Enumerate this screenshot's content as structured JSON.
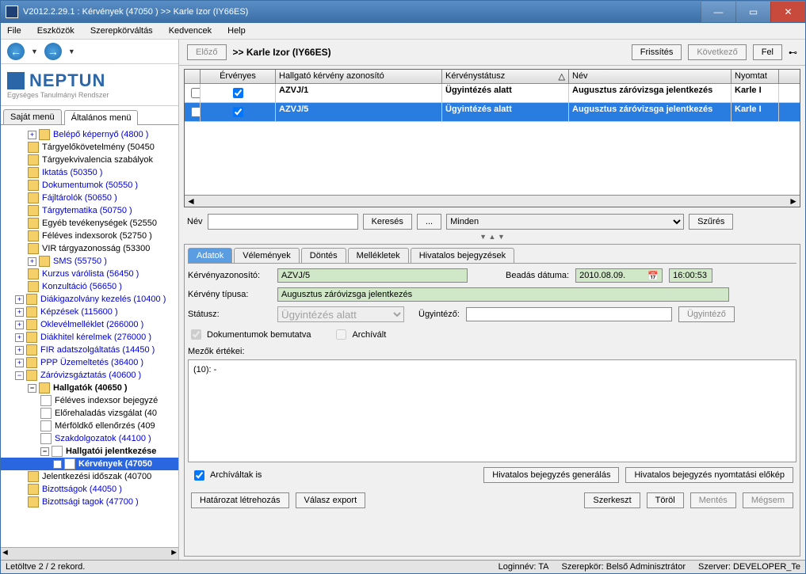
{
  "window": {
    "title": "V2012.2.29.1 : Kérvények (47050  )  >> Karle Izor (IY66ES)"
  },
  "menu": {
    "file": "File",
    "eszkozok": "Eszközök",
    "szerepkor": "Szerepkörváltás",
    "kedvencek": "Kedvencek",
    "help": "Help"
  },
  "logo": {
    "brand": "NEPTUN",
    "sub": "Egységes Tanulmányi Rendszer"
  },
  "leftTabs": {
    "sajat": "Saját menü",
    "altalanos": "Általános menü"
  },
  "tree": {
    "belepo": "Belépő képernyő (4800  )",
    "targykov": "Tárgyelőkövetelmény (50450",
    "targyekv": "Tárgyekvivalencia szabályok",
    "iktatas": "Iktatás (50350  )",
    "dokumentumok": "Dokumentumok (50550  )",
    "fajltarolo": "Fájltárolók (50650  )",
    "targytematika": "Tárgytematika (50750  )",
    "egyeb": "Egyéb tevékenységek (52550",
    "feleves": "Féléves indexsorok (52750  )",
    "vir": "VIR tárgyazonosság (53300",
    "sms": "SMS (55750  )",
    "kurzus": "Kurzus várólista (56450  )",
    "konzultacio": "Konzultáció (56650  )",
    "diakig": "Diákigazolvány kezelés (10400  )",
    "kepzesek": "Képzések (115600  )",
    "oklevel": "Oklevélmelléklet (266000  )",
    "diakhitel": "Diákhitel kérelmek (276000  )",
    "fir": "FIR adatszolgáltatás (14450  )",
    "ppp": "PPP Üzemeltetés (36400  )",
    "zarovizsga": "Záróvizsgáztatás (40600  )",
    "hallgatok": "Hallgatók  (40650  )",
    "felindex": "Féléves indexsor bejegyzé",
    "elorehaladas": "Előrehaladás vizsgálat (40",
    "merfoldko": "Mérföldkő ellenőrzés (409",
    "szakdolg": "Szakdolgozatok (44100  )",
    "hallgjel": "Hallgatói jelentkezése",
    "kervenyek": "Kérvények  (47050",
    "jelidoszak": "Jelentkezési időszak (40700",
    "bizottsagok": "Bizottságok (44050  )",
    "bizotttagok": "Bizottsági tagok (47700  )"
  },
  "toolbar": {
    "elozo": "Előző",
    "crumb": ">> Karle Izor (IY66ES)",
    "frissites": "Frissítés",
    "kovetkezo": "Következő",
    "fel": "Fel"
  },
  "grid": {
    "hdr": {
      "ervenyes": "Érvényes",
      "azon": "Hallgató kérvény azonosító",
      "status": "Kérvénystátusz",
      "nev": "Név",
      "nyomtat": "Nyomtat"
    },
    "rows": [
      {
        "azon": "AZVJ/1",
        "status": "Ügyintézés alatt",
        "nev": "Augusztus záróvizsga jelentkezés",
        "ny": "Karle I"
      },
      {
        "azon": "AZVJ/5",
        "status": "Ügyintézés alatt",
        "nev": "Augusztus záróvizsga jelentkezés",
        "ny": "Karle I"
      }
    ]
  },
  "search": {
    "nevLabel": "Név",
    "kereses": "Keresés",
    "dots": "...",
    "minden": "Minden",
    "szures": "Szűrés"
  },
  "detailTabs": {
    "adatok": "Adatok",
    "velemenyek": "Vélemények",
    "dontes": "Döntés",
    "mellekletek": "Mellékletek",
    "hivatalos": "Hivatalos bejegyzések"
  },
  "form": {
    "azonLabel": "Kérvényazonosító:",
    "azon": "AZVJ/5",
    "beadasLabel": "Beadás dátuma:",
    "beadDate": "2010.08.09.",
    "beadTime": "16:00:53",
    "tipusLabel": "Kérvény típusa:",
    "tipus": "Augusztus záróvizsga jelentkezés",
    "statuszLabel": "Státusz:",
    "statusz": "Ügyintézés alatt",
    "ugyLabel": "Ügyintéző:",
    "ugyBtn": "Ügyintéző",
    "dokBemut": "Dokumentumok bemutatva",
    "archivalt": "Archívált",
    "mezokLabel": "Mezők értékei:",
    "mezokContent": "(10): -"
  },
  "bottom": {
    "archIs": "Archíváltak is",
    "hivGen": "Hivatalos bejegyzés generálás",
    "hivNyomt": "Hivatalos bejegyzés nyomtatási előkép",
    "hatarozat": "Határozat létrehozás",
    "valaszExp": "Válasz export",
    "szerkeszt": "Szerkeszt",
    "torol": "Töröl",
    "mentes": "Mentés",
    "megsem": "Mégsem"
  },
  "status": {
    "rec": "Letöltve 2 / 2 rekord.",
    "login": "Loginnév: TA",
    "szerep": "Szerepkör: Belső Adminisztrátor",
    "szerver": "Szerver: DEVELOPER_Te"
  }
}
